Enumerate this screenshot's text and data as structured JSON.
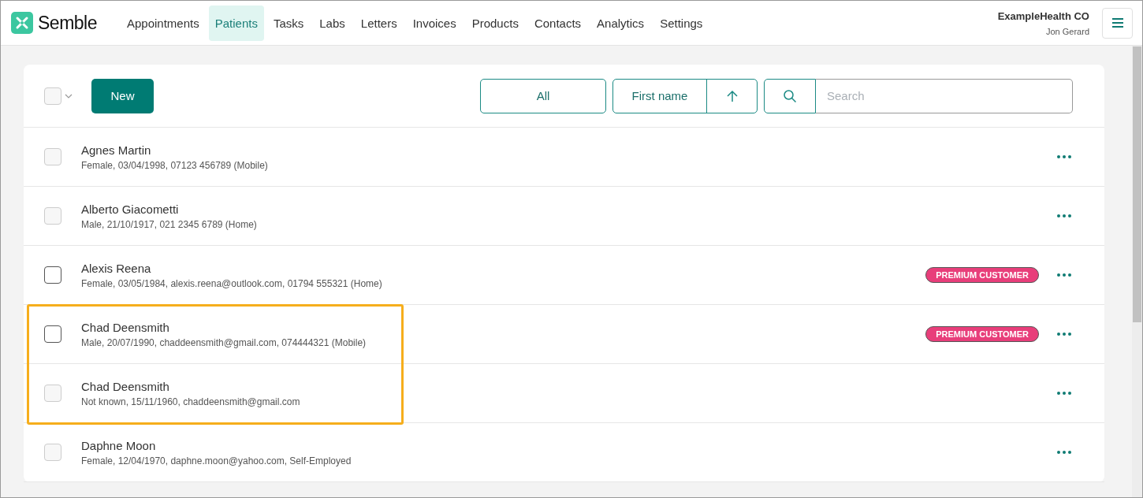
{
  "brand": {
    "name": "Semble"
  },
  "nav": [
    {
      "label": "Appointments",
      "selected": false
    },
    {
      "label": "Patients",
      "selected": true
    },
    {
      "label": "Tasks",
      "selected": false
    },
    {
      "label": "Labs",
      "selected": false
    },
    {
      "label": "Letters",
      "selected": false
    },
    {
      "label": "Invoices",
      "selected": false
    },
    {
      "label": "Products",
      "selected": false
    },
    {
      "label": "Contacts",
      "selected": false
    },
    {
      "label": "Analytics",
      "selected": false
    },
    {
      "label": "Settings",
      "selected": false
    }
  ],
  "account": {
    "organization": "ExampleHealth CO",
    "user": "Jon Gerard"
  },
  "toolbar": {
    "select_all": {
      "disabled": true
    },
    "new_button": "New",
    "filter": "All",
    "sort_field": "First name",
    "search": {
      "placeholder": "Search"
    }
  },
  "patients": [
    {
      "name": "Agnes Martin",
      "details": "Female, 03/04/1998, 07123 456789 (Mobile)",
      "disabled": true,
      "highlighted": false
    },
    {
      "name": "Alberto Giacometti",
      "details": "Male, 21/10/1917, 021 2345 6789 (Home)",
      "disabled": true,
      "highlighted": false
    },
    {
      "name": "Alexis Reena",
      "details": "Female, 03/05/1984, alexis.reena@outlook.com, 01794 555321 (Home)",
      "tag": "PREMIUM CUSTOMER",
      "disabled": false,
      "highlighted": false
    },
    {
      "name": "Chad Deensmith",
      "details": "Male, 20/07/1990, chaddeensmith@gmail.com, 074444321 (Mobile)",
      "tag": "PREMIUM CUSTOMER",
      "disabled": false,
      "highlighted": true
    },
    {
      "name": "Chad Deensmith",
      "details": "Not known, 15/11/1960, chaddeensmith@gmail.com",
      "disabled": true,
      "highlighted": true
    },
    {
      "name": "Daphne Moon",
      "details": "Female, 12/04/1970, daphne.moon@yahoo.com, Self-Employed",
      "disabled": true,
      "highlighted": false
    }
  ]
}
